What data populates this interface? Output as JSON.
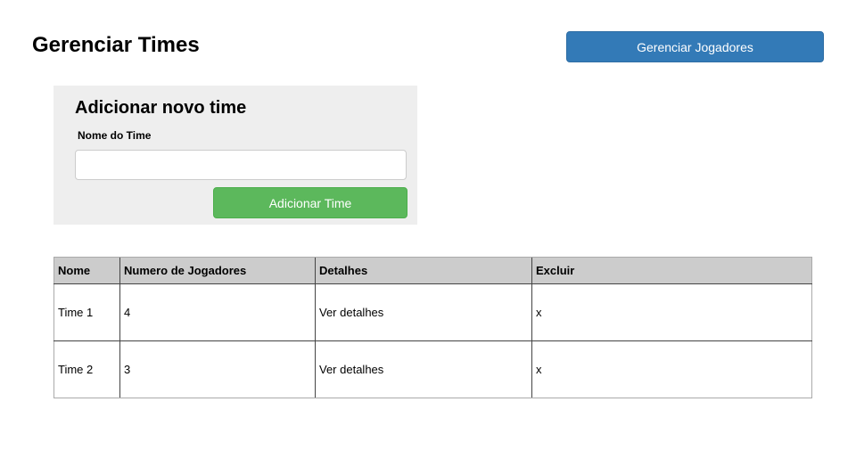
{
  "header": {
    "title": "Gerenciar Times",
    "manage_players_label": "Gerenciar Jogadores"
  },
  "form": {
    "title": "Adicionar novo time",
    "name_label": "Nome do Time",
    "name_value": "",
    "submit_label": "Adicionar Time"
  },
  "table": {
    "headers": [
      "Nome",
      "Numero de Jogadores",
      "Detalhes",
      "Excluir"
    ],
    "rows": [
      {
        "name": "Time 1",
        "players": "4",
        "details": "Ver detalhes",
        "delete": "x"
      },
      {
        "name": "Time 2",
        "players": "3",
        "details": "Ver detalhes",
        "delete": "x"
      }
    ]
  },
  "colors": {
    "primary": "#337ab7",
    "success": "#5cb85c",
    "card_bg": "#eeeeee",
    "table_header_bg": "#cccccc"
  }
}
